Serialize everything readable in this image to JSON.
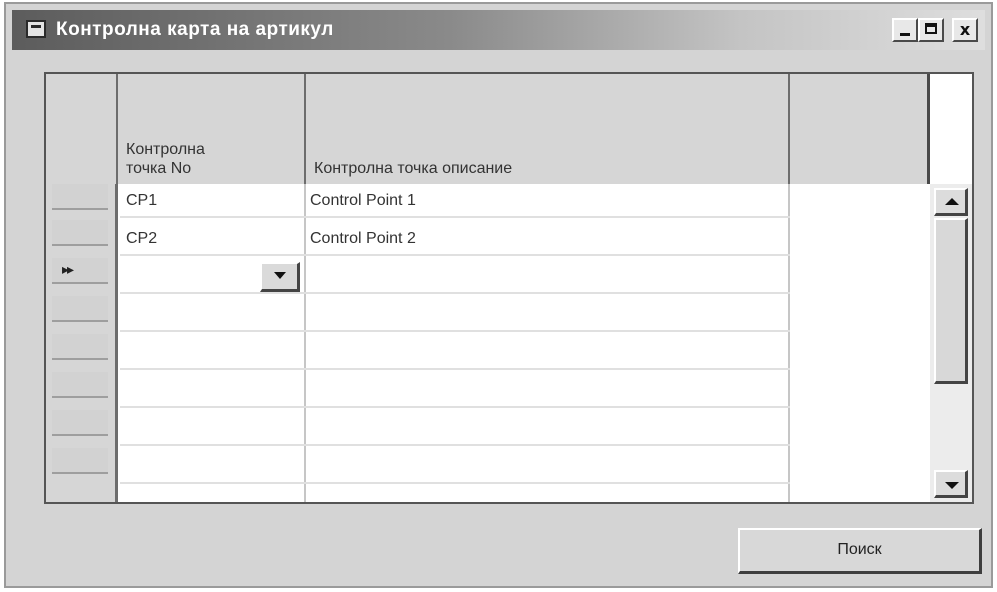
{
  "window": {
    "title": "Контролна карта на артикул",
    "minimize_icon": "minimize-icon",
    "maximize_icon": "maximize-icon",
    "close_glyph": "x",
    "close_icon": "close-icon"
  },
  "grid": {
    "columns": [
      {
        "label": "Контролна\nточка No"
      },
      {
        "label": "Контролна точка описание"
      },
      {
        "label": ""
      }
    ],
    "rows": [
      {
        "no": "CP1",
        "description": "Control Point 1"
      },
      {
        "no": "CP2",
        "description": "Control Point 2"
      },
      {
        "no": "",
        "description": ""
      }
    ],
    "current_row_marker": "▸▸"
  },
  "footer": {
    "search_button_label": "Поиск"
  },
  "colors": {
    "window_bg": "#d4d4d4",
    "title_gradient_start": "#5c5c5c",
    "grid_bg": "#ffffff"
  }
}
